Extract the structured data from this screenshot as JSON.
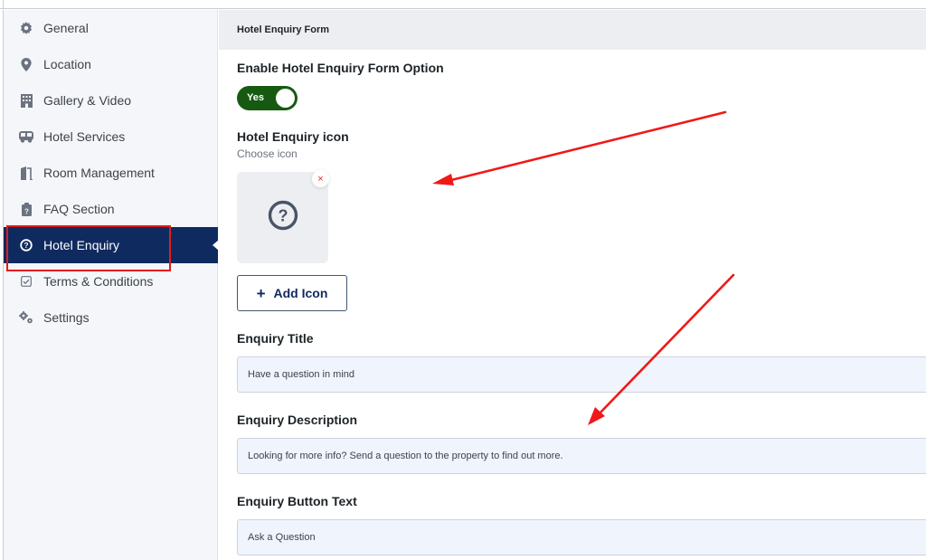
{
  "sidebar": {
    "items": [
      {
        "label": "General",
        "icon": "gear-icon",
        "active": false
      },
      {
        "label": "Location",
        "icon": "map-pin-icon",
        "active": false
      },
      {
        "label": "Gallery & Video",
        "icon": "building-icon",
        "active": false
      },
      {
        "label": "Hotel Services",
        "icon": "bus-icon",
        "active": false
      },
      {
        "label": "Room Management",
        "icon": "door-icon",
        "active": false
      },
      {
        "label": "FAQ Section",
        "icon": "clipboard-question-icon",
        "active": false
      },
      {
        "label": "Hotel Enquiry",
        "icon": "question-circle-icon",
        "active": true
      },
      {
        "label": "Terms & Conditions",
        "icon": "checkbox-icon",
        "active": false
      },
      {
        "label": "Settings",
        "icon": "gears-icon",
        "active": false
      }
    ]
  },
  "main": {
    "section_title": "Hotel Enquiry Form",
    "enable_option": {
      "label": "Enable Hotel Enquiry Form Option",
      "toggle_label": "Yes",
      "enabled": true
    },
    "icon_field": {
      "label": "Hotel Enquiry icon",
      "sublabel": "Choose icon",
      "selected_icon": "question-circle-icon",
      "remove_label": "×",
      "add_button_label": "Add Icon",
      "add_button_icon": "+"
    },
    "enquiry_title": {
      "label": "Enquiry Title",
      "value": "Have a question in mind"
    },
    "enquiry_description": {
      "label": "Enquiry Description",
      "value": "Looking for more info? Send a question to the property to find out more."
    },
    "enquiry_button_text": {
      "label": "Enquiry Button Text",
      "value": "Ask a Question"
    }
  },
  "colors": {
    "sidebar_active_bg": "#0f2a5e",
    "toggle_on": "#165a12",
    "annotation_red": "#e31b1b",
    "input_bg": "#f0f4fc"
  }
}
